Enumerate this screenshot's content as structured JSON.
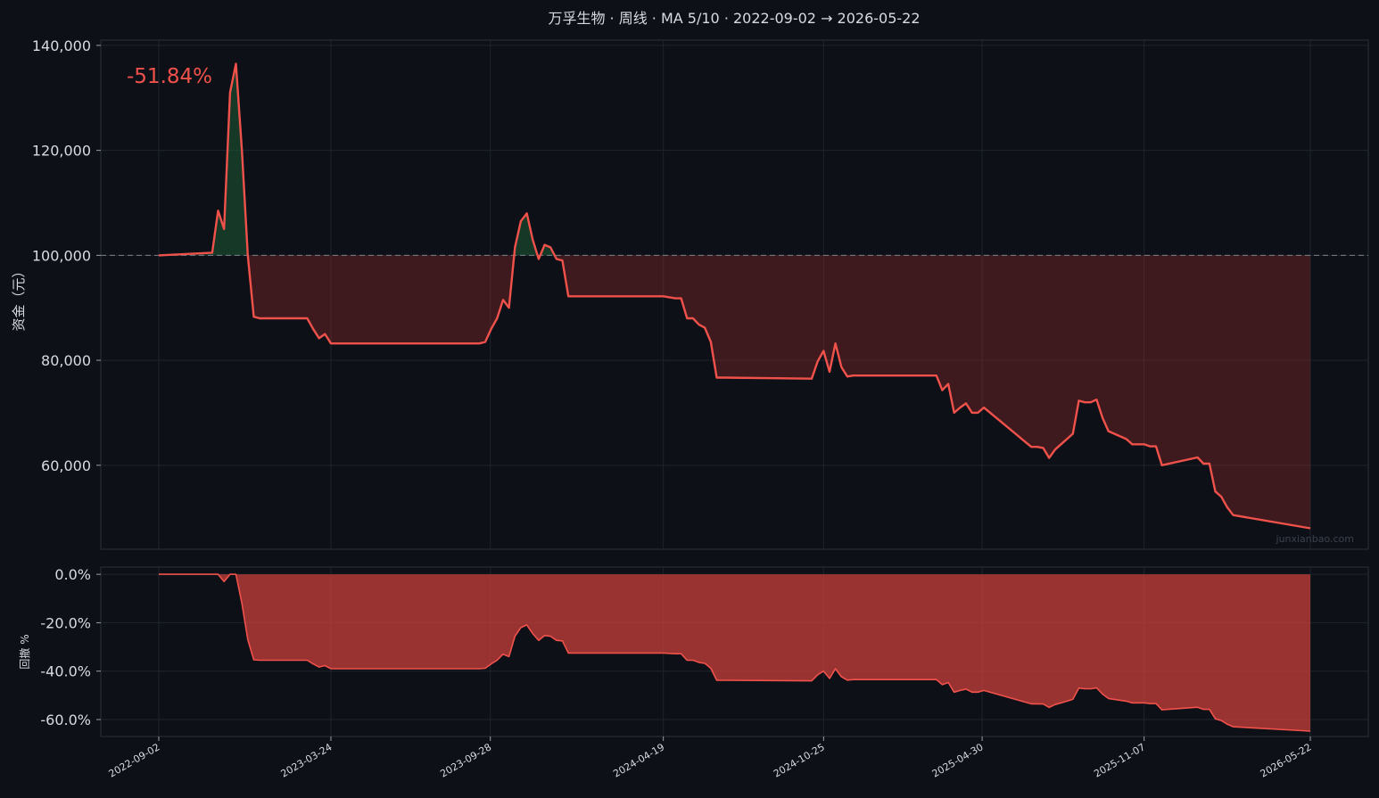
{
  "chart_data": [
    {
      "type": "area",
      "panel": "equity",
      "title": "万孚生物 · 周线 · MA 5/10 · 2022-09-02 → 2026-05-22",
      "ylabel": "资金（元）",
      "xlabel": "",
      "return_label": "-51.84%",
      "watermark": "junxianbao.com",
      "baseline": 100000,
      "xlim": [
        "2022-09-02",
        "2026-05-22"
      ],
      "ylim": [
        44000,
        141000
      ],
      "yticks": [
        60000,
        80000,
        100000,
        120000,
        140000
      ],
      "ytick_labels": [
        "60,000",
        "80,000",
        "100,000",
        "120,000",
        "140,000"
      ],
      "xtick_labels": [
        "2022-09-02",
        "2023-03-24",
        "2023-09-28",
        "2024-04-19",
        "2024-10-25",
        "2025-04-30",
        "2025-11-07",
        "2026-05-22"
      ],
      "grid": true,
      "series": [
        {
          "x": [
            "2022-09-02",
            "2022-11-04",
            "2022-11-11",
            "2022-11-18",
            "2022-11-25",
            "2022-12-02",
            "2022-12-09",
            "2022-12-16",
            "2022-12-23",
            "2022-12-30",
            "2023-01-06",
            "2023-01-13",
            "2023-01-20",
            "2023-02-24",
            "2023-03-03",
            "2023-03-10",
            "2023-03-17",
            "2023-03-24",
            "2023-09-15",
            "2023-09-22",
            "2023-09-29",
            "2023-10-06",
            "2023-10-13",
            "2023-10-20",
            "2023-10-27",
            "2023-11-03",
            "2023-11-10",
            "2023-11-17",
            "2023-11-24",
            "2023-12-01",
            "2023-12-08",
            "2023-12-15",
            "2023-12-22",
            "2023-12-29",
            "2024-01-05",
            "2024-04-19",
            "2024-05-03",
            "2024-05-10",
            "2024-05-17",
            "2024-05-24",
            "2024-05-31",
            "2024-06-07",
            "2024-06-14",
            "2024-06-21",
            "2024-06-28",
            "2024-10-11",
            "2024-10-18",
            "2024-10-25",
            "2024-11-01",
            "2024-11-08",
            "2024-11-15",
            "2024-11-22",
            "2024-11-29",
            "2024-12-06",
            "2025-03-07",
            "2025-03-14",
            "2025-03-21",
            "2025-03-28",
            "2025-04-04",
            "2025-04-11",
            "2025-04-18",
            "2025-04-25",
            "2025-05-02",
            "2025-06-27",
            "2025-07-04",
            "2025-07-11",
            "2025-07-18",
            "2025-07-25",
            "2025-08-01",
            "2025-08-08",
            "2025-08-15",
            "2025-08-22",
            "2025-08-29",
            "2025-09-05",
            "2025-09-12",
            "2025-09-19",
            "2025-09-26",
            "2025-10-17",
            "2025-10-24",
            "2025-11-07",
            "2025-11-14",
            "2025-11-21",
            "2025-11-28",
            "2026-01-09",
            "2026-01-16",
            "2026-01-23",
            "2026-01-30",
            "2026-02-06",
            "2026-02-13",
            "2026-02-20",
            "2026-05-22"
          ],
          "y": [
            100000,
            100500,
            108500,
            105000,
            131000,
            136500,
            120000,
            100000,
            88300,
            88000,
            88000,
            88000,
            88000,
            88000,
            86000,
            84200,
            85000,
            83200,
            83200,
            83500,
            86000,
            88000,
            91500,
            90000,
            101500,
            106500,
            108000,
            103000,
            99300,
            102000,
            101500,
            99300,
            99000,
            92200,
            92200,
            92200,
            91800,
            91800,
            88000,
            88000,
            86800,
            86200,
            83500,
            76700,
            76700,
            76500,
            79800,
            81800,
            77800,
            83200,
            78700,
            76900,
            77100,
            77100,
            77100,
            74300,
            75500,
            70000,
            71000,
            71800,
            70000,
            70000,
            71000,
            63500,
            63500,
            63300,
            61400,
            63000,
            64000,
            65000,
            66000,
            72300,
            72000,
            72000,
            72500,
            69000,
            66500,
            65000,
            64000,
            64000,
            63600,
            63600,
            60000,
            61500,
            60300,
            60300,
            55000,
            54000,
            52000,
            50500,
            48000
          ]
        }
      ]
    },
    {
      "type": "area",
      "panel": "drawdown",
      "ylabel": "回撤 %",
      "xlim": [
        "2022-09-02",
        "2026-05-22"
      ],
      "ylim": [
        -67,
        3
      ],
      "yticks": [
        0,
        -20,
        -40,
        -60
      ],
      "ytick_labels": [
        "0.0%",
        "-20.0%",
        "-40.0%",
        "-60.0%"
      ],
      "xtick_labels": [
        "2022-09-02",
        "2023-03-24",
        "2023-09-28",
        "2024-04-19",
        "2024-10-25",
        "2025-04-30",
        "2025-11-07",
        "2026-05-22"
      ],
      "grid": true,
      "series": [
        {
          "x": [
            "2022-09-02",
            "2022-11-04",
            "2022-11-11",
            "2022-11-18",
            "2022-11-25",
            "2022-12-02",
            "2022-12-09",
            "2022-12-16",
            "2022-12-23",
            "2022-12-30",
            "2023-01-06",
            "2023-01-13",
            "2023-01-20",
            "2023-02-24",
            "2023-03-03",
            "2023-03-10",
            "2023-03-17",
            "2023-03-24",
            "2023-09-15",
            "2023-09-22",
            "2023-09-29",
            "2023-10-06",
            "2023-10-13",
            "2023-10-20",
            "2023-10-27",
            "2023-11-03",
            "2023-11-10",
            "2023-11-17",
            "2023-11-24",
            "2023-12-01",
            "2023-12-08",
            "2023-12-15",
            "2023-12-22",
            "2023-12-29",
            "2024-01-05",
            "2024-04-19",
            "2024-05-03",
            "2024-05-10",
            "2024-05-17",
            "2024-05-24",
            "2024-05-31",
            "2024-06-07",
            "2024-06-14",
            "2024-06-21",
            "2024-06-28",
            "2024-10-11",
            "2024-10-18",
            "2024-10-25",
            "2024-11-01",
            "2024-11-08",
            "2024-11-15",
            "2024-11-22",
            "2024-11-29",
            "2024-12-06",
            "2025-03-07",
            "2025-03-14",
            "2025-03-21",
            "2025-03-28",
            "2025-04-04",
            "2025-04-11",
            "2025-04-18",
            "2025-04-25",
            "2025-05-02",
            "2025-06-27",
            "2025-07-04",
            "2025-07-11",
            "2025-07-18",
            "2025-07-25",
            "2025-08-01",
            "2025-08-08",
            "2025-08-15",
            "2025-08-22",
            "2025-08-29",
            "2025-09-05",
            "2025-09-12",
            "2025-09-19",
            "2025-09-26",
            "2025-10-17",
            "2025-10-24",
            "2025-11-07",
            "2025-11-14",
            "2025-11-21",
            "2025-11-28",
            "2026-01-09",
            "2026-01-16",
            "2026-01-23",
            "2026-01-30",
            "2026-02-06",
            "2026-02-13",
            "2026-02-20",
            "2026-05-22"
          ],
          "y": [
            0,
            0,
            0,
            -3,
            0,
            0,
            -12,
            -27,
            -35.3,
            -35.5,
            -35.5,
            -35.5,
            -35.5,
            -35.5,
            -37,
            -38.3,
            -37.7,
            -39,
            -39,
            -38.8,
            -37,
            -35.5,
            -33,
            -34,
            -25.6,
            -22,
            -20.9,
            -24.5,
            -27.3,
            -25.3,
            -25.6,
            -27.3,
            -27.5,
            -32.5,
            -32.5,
            -32.5,
            -32.8,
            -32.8,
            -35.5,
            -35.5,
            -36.4,
            -36.8,
            -38.8,
            -43.8,
            -43.8,
            -44,
            -41.5,
            -40,
            -43,
            -39,
            -42.3,
            -43.7,
            -43.5,
            -43.5,
            -43.5,
            -45.6,
            -44.7,
            -48.7,
            -48,
            -47.4,
            -48.7,
            -48.7,
            -48,
            -53.5,
            -53.5,
            -53.6,
            -55,
            -53.8,
            -53.1,
            -52.4,
            -51.6,
            -47,
            -47.3,
            -47.3,
            -46.9,
            -49.5,
            -51.3,
            -52.4,
            -53.1,
            -53.1,
            -53.4,
            -53.4,
            -56,
            -54.9,
            -55.8,
            -55.8,
            -59.7,
            -60.4,
            -61.9,
            -63,
            -64.8
          ]
        }
      ]
    }
  ]
}
